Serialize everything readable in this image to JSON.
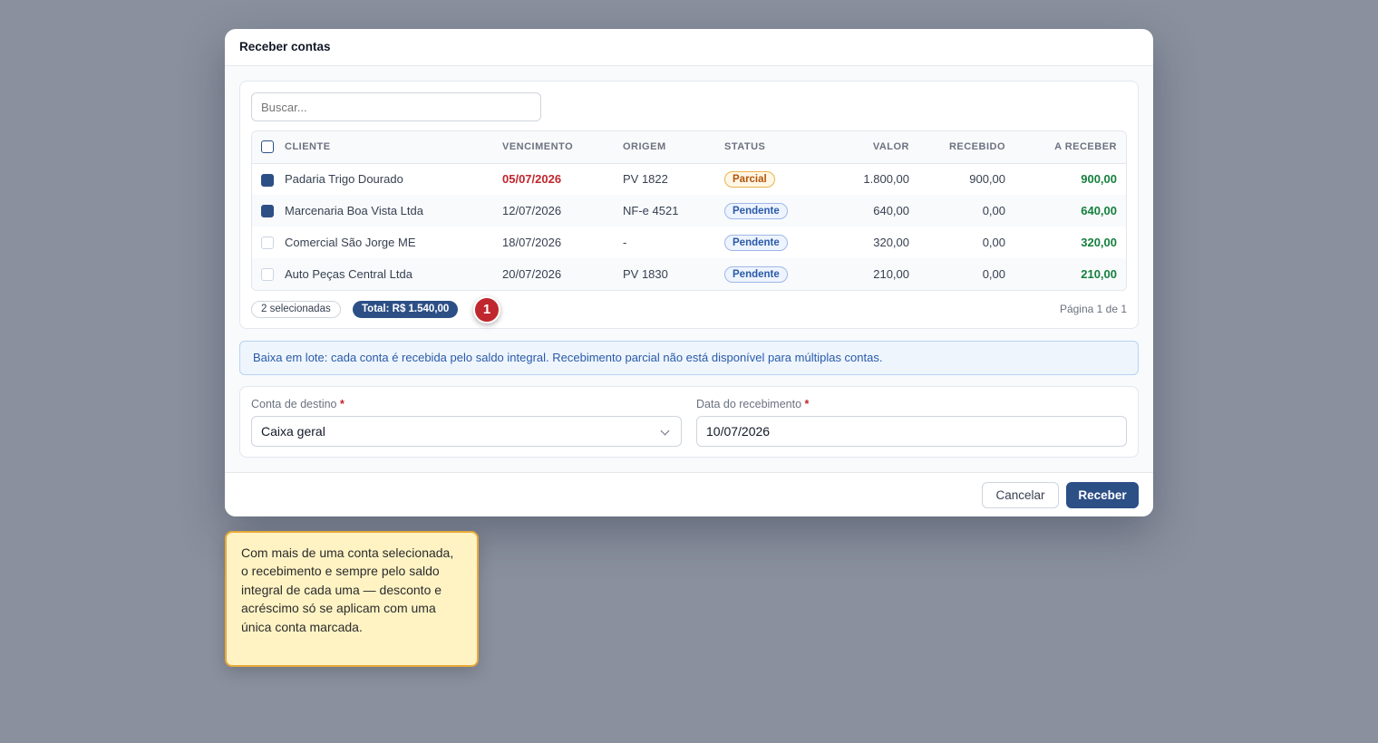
{
  "modal": {
    "title": "Receber contas"
  },
  "search": {
    "placeholder": "Buscar..."
  },
  "table": {
    "headers": {
      "cliente": "CLIENTE",
      "vencimento": "VENCIMENTO",
      "origem": "ORIGEM",
      "status": "STATUS",
      "valor": "VALOR",
      "recebido": "RECEBIDO",
      "a_receber": "A RECEBER"
    },
    "rows": [
      {
        "checked": true,
        "cliente": "Padaria Trigo Dourado",
        "vencimento": "05/07/2026",
        "overdue": true,
        "origem": "PV 1822",
        "status": "Parcial",
        "valor": "1.800,00",
        "recebido": "900,00",
        "a_receber": "900,00"
      },
      {
        "checked": true,
        "cliente": "Marcenaria Boa Vista Ltda",
        "vencimento": "12/07/2026",
        "overdue": false,
        "origem": "NF-e 4521",
        "status": "Pendente",
        "valor": "640,00",
        "recebido": "0,00",
        "a_receber": "640,00"
      },
      {
        "checked": false,
        "cliente": "Comercial São Jorge ME",
        "vencimento": "18/07/2026",
        "overdue": false,
        "origem": "-",
        "status": "Pendente",
        "valor": "320,00",
        "recebido": "0,00",
        "a_receber": "320,00"
      },
      {
        "checked": false,
        "cliente": "Auto Peças Central Ltda",
        "vencimento": "20/07/2026",
        "overdue": false,
        "origem": "PV 1830",
        "status": "Pendente",
        "valor": "210,00",
        "recebido": "0,00",
        "a_receber": "210,00"
      }
    ]
  },
  "summary": {
    "selected": "2 selecionadas",
    "total": "Total: R$ 1.540,00",
    "marker": "1",
    "page": "Página 1 de 1"
  },
  "info_banner": "Baixa em lote: cada conta é recebida pelo saldo integral. Recebimento parcial não está disponível para múltiplas contas.",
  "form": {
    "conta_label": "Conta de destino",
    "conta_value": "Caixa geral",
    "data_label": "Data do recebimento",
    "data_value": "10/07/2026",
    "required_mark": "*"
  },
  "footer": {
    "cancel": "Cancelar",
    "submit": "Receber"
  },
  "tooltip": "Com mais de uma conta selecionada, o recebimento e sempre pelo saldo integral de cada uma — desconto e acréscimo só se aplicam com uma única conta marcada.",
  "colors": {
    "primary": "#2c4f86",
    "overdue": "#c0262d",
    "receivable": "#15803d",
    "backdrop": "#8a909e"
  }
}
